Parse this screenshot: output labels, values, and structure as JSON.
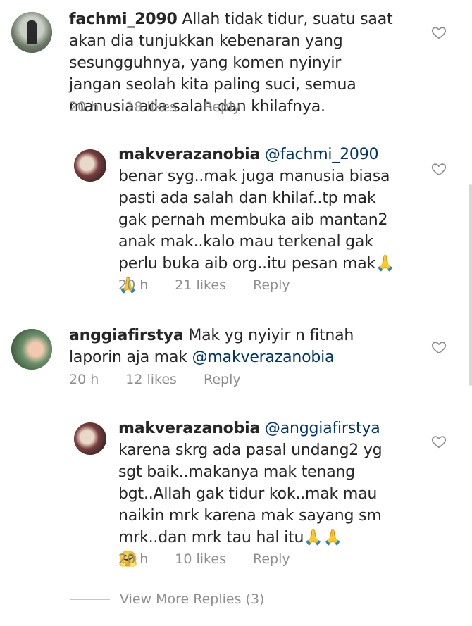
{
  "comments": [
    {
      "username": "fachmi_2090",
      "text": " Allah tidak tidur, suatu saat akan dia tunjukkan kebenaran yang sesungguhnya, yang komen nyinyir jangan seolah kita paling suci, semua manusia ada salah dan khilafnya.",
      "time": "20 h",
      "likes": "18 likes",
      "reply": "Reply"
    },
    {
      "username": "makverazanobia",
      "mention": "@fachmi_2090",
      "text": " benar syg..mak juga manusia biasa pasti ada salah dan khilaf..tp mak gak pernah membuka aib mantan2 anak mak..kalo mau terkenal gak perlu buka aib org..itu pesan mak",
      "emoji": "🙏🙏",
      "time": "20 h",
      "likes": "21 likes",
      "reply": "Reply"
    },
    {
      "username": "anggiafirstya",
      "text": " Mak yg nyiyir n fitnah laporin aja mak ",
      "mention": "@makverazanobia",
      "time": "20 h",
      "likes": "12 likes",
      "reply": "Reply"
    },
    {
      "username": "makverazanobia",
      "mention": "@anggiafirstya",
      "text": " karena skrg ada pasal undang2 yg sgt baik..makanya mak tenang bgt..Allah gak tidur kok..mak mau naikin mrk karena mak sayang sm mrk..dan mrk tau hal itu",
      "emoji": "🙏🙏",
      "emoji2": "🤗",
      "time": "20 h",
      "likes": "10 likes",
      "reply": "Reply"
    }
  ],
  "view_more": "View More Replies (3)",
  "icons": {
    "like": "heart-outline-icon"
  },
  "colors": {
    "mention": "#003569",
    "meta": "#8e8e8e"
  }
}
